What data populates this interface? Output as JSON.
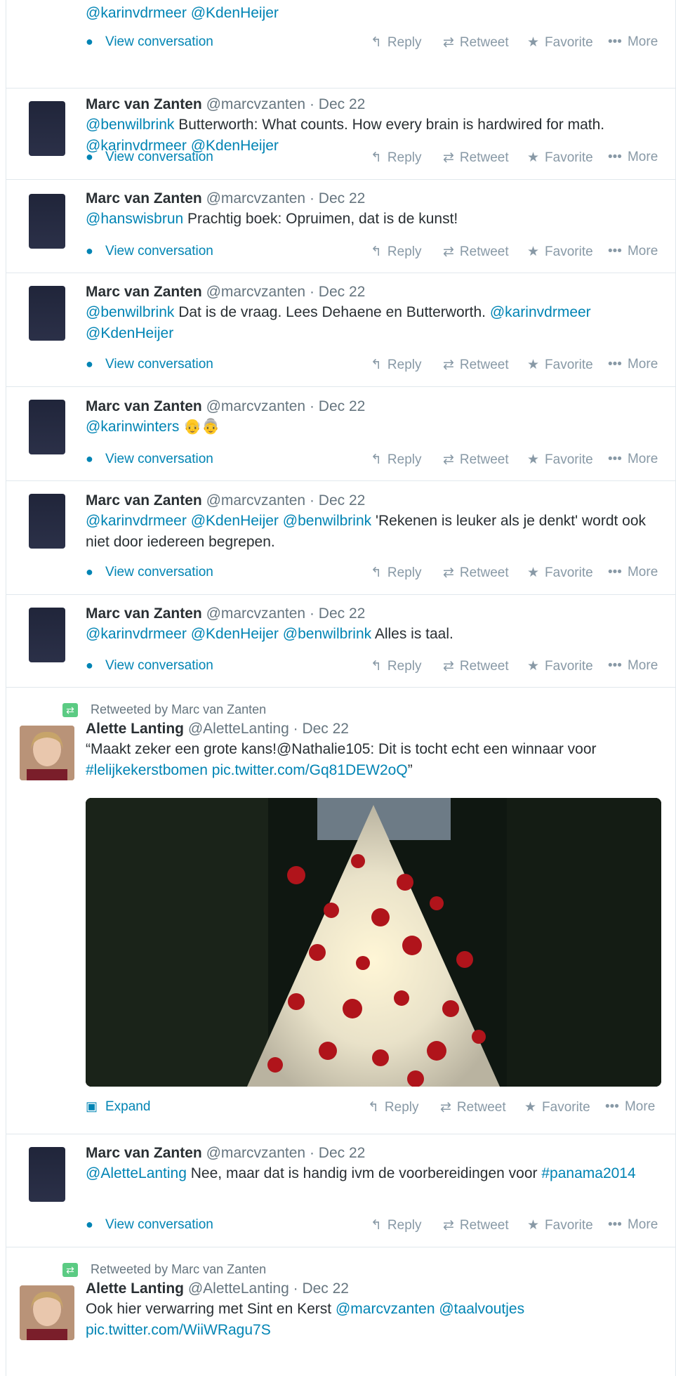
{
  "labels": {
    "view_conversation": "View conversation",
    "expand": "Expand",
    "reply": "Reply",
    "retweet": "Retweet",
    "favorite": "Favorite",
    "more": "More",
    "dot": "·",
    "retweeted_by": "Retweeted by Marc van Zanten"
  },
  "icons": {
    "conversation": "speech-bubble-icon",
    "expand": "expand-icon",
    "reply": "reply-arrow-icon",
    "retweet": "retweet-icon",
    "favorite": "star-icon",
    "more": "ellipsis-icon",
    "retweeted": "retweet-badge-icon"
  },
  "colors": {
    "link": "#0084b4",
    "muted": "#8899a6",
    "retweet_badge": "#5bcb83"
  },
  "tweets": [
    {
      "text_parts": [
        "@karinvdrmeer",
        " ",
        "@KdenHeijer"
      ]
    },
    {
      "name": "Marc van Zanten",
      "handle": "@marcvzanten",
      "time": "Dec 22",
      "text_parts": [
        "@benwilbrink",
        " Butterworth: What counts. How every brain is hardwired for math. ",
        "@karinvdrmeer",
        " ",
        "@KdenHeijer"
      ]
    },
    {
      "name": "Marc van Zanten",
      "handle": "@marcvzanten",
      "time": "Dec 22",
      "text_parts": [
        "@hanswisbrun",
        " Prachtig boek: Opruimen, dat is de kunst!"
      ]
    },
    {
      "name": "Marc van Zanten",
      "handle": "@marcvzanten",
      "time": "Dec 22",
      "text_parts": [
        "@benwilbrink",
        " Dat is de vraag. Lees Dehaene en Butterworth. ",
        "@karinvdrmeer",
        " ",
        "@KdenHeijer"
      ]
    },
    {
      "name": "Marc van Zanten",
      "handle": "@marcvzanten",
      "time": "Dec 22",
      "text_parts": [
        "@karinwinters",
        " 👴👵"
      ]
    },
    {
      "name": "Marc van Zanten",
      "handle": "@marcvzanten",
      "time": "Dec 22",
      "text_parts": [
        "@karinvdrmeer",
        " ",
        "@KdenHeijer",
        " ",
        "@benwilbrink",
        " 'Rekenen is leuker als je denkt' wordt ook niet door iedereen begrepen."
      ]
    },
    {
      "name": "Marc van Zanten",
      "handle": "@marcvzanten",
      "time": "Dec 22",
      "text_parts": [
        "@karinvdrmeer",
        " ",
        "@KdenHeijer",
        " ",
        "@benwilbrink",
        " Alles is taal."
      ]
    },
    {
      "name": "Alette Lanting",
      "handle": "@AletteLanting",
      "time": "Dec 22",
      "text_parts": [
        "“Maakt zeker een grote kans!@Nathalie105: Dit is tocht echt een winnaar voor ",
        "#lelijkekerstbomen",
        " ",
        "pic.twitter.com/Gq81DEW2oQ",
        "”"
      ]
    },
    {
      "name": "Marc van Zanten",
      "handle": "@marcvzanten",
      "time": "Dec 22",
      "text_parts": [
        "@AletteLanting",
        " Nee, maar dat is handig ivm de voorbereidingen voor ",
        "#panama2014"
      ]
    },
    {
      "name": "Alette Lanting",
      "handle": "@AletteLanting",
      "time": "Dec 22",
      "text_parts": [
        "Ook hier verwarring met Sint en Kerst ",
        "@marcvzanten",
        " ",
        "@taalvoutjes",
        " ",
        "pic.twitter.com/WiiWRagu7S"
      ]
    }
  ]
}
